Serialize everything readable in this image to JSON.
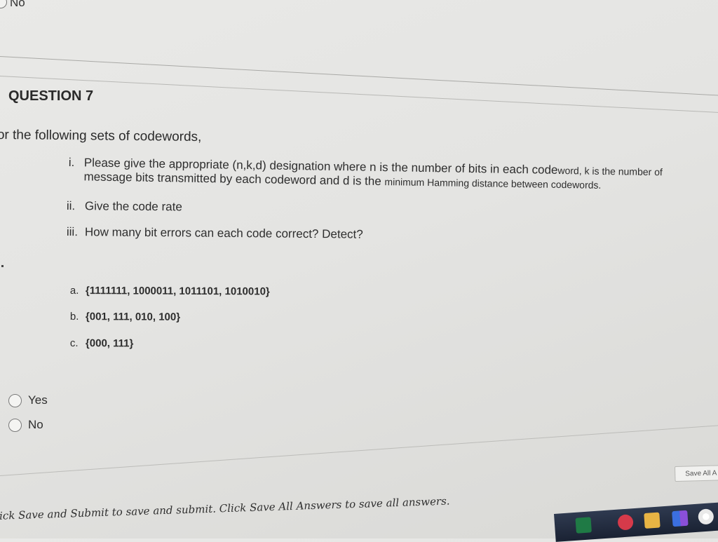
{
  "previous_question": {
    "last_option_label": "No"
  },
  "question": {
    "title": "QUESTION 7",
    "intro": "or the following sets of codewords,",
    "subparts": [
      {
        "num": "i.",
        "line1_large": "Please give the appropriate (n,k,d) designation where n is the number of bits in each code",
        "line1_small": "word, k is the number of",
        "line2_large": "message bits transmitted by each codeword and d is the",
        "line2_small": "minimum Hamming distance between codewords."
      },
      {
        "num": "ii.",
        "text": "Give the code rate"
      },
      {
        "num": "iii.",
        "text": "How many bit errors can each code correct? Detect?"
      }
    ],
    "codeword_sets": [
      {
        "letter": "a.",
        "text": "{1111111, 1000011, 1011101, 1010010}"
      },
      {
        "letter": "b.",
        "text": "{001, 111, 010, 100}"
      },
      {
        "letter": "c.",
        "text": "{000, 111}"
      }
    ],
    "options": [
      {
        "label": "Yes",
        "selected": false
      },
      {
        "label": "No",
        "selected": false
      }
    ]
  },
  "footer": {
    "save_all_button": "Save All A",
    "note": "lick Save and Submit to save and submit. Click Save All Answers to save all answers."
  },
  "taskbar": {
    "icons": [
      "excel-icon",
      "mail-icon",
      "file-explorer-icon",
      "tiles-icon",
      "chrome-icon"
    ]
  }
}
